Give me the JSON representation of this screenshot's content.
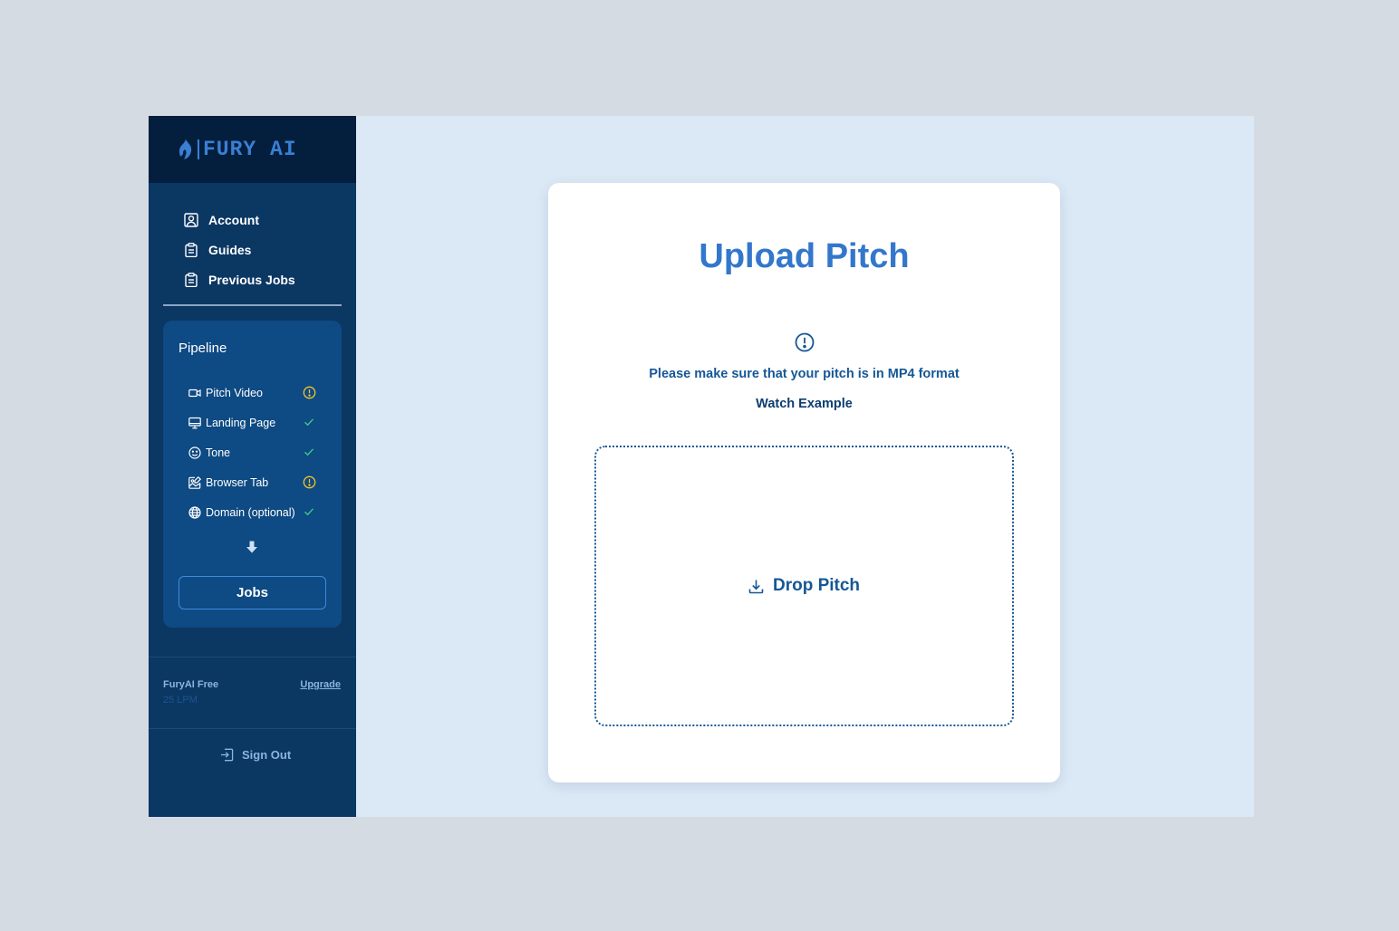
{
  "brand": {
    "name": "FURY AI",
    "logo_icon": "flame-logo",
    "color": "#3b7fd4"
  },
  "nav": {
    "items": [
      {
        "label": "Account",
        "icon": "user-square-icon"
      },
      {
        "label": "Guides",
        "icon": "clipboard-icon"
      },
      {
        "label": "Previous Jobs",
        "icon": "clipboard-icon"
      }
    ]
  },
  "pipeline": {
    "title": "Pipeline",
    "items": [
      {
        "label": "Pitch Video",
        "icon": "video-icon",
        "status": "warning"
      },
      {
        "label": "Landing Page",
        "icon": "monitor-icon",
        "status": "done"
      },
      {
        "label": "Tone",
        "icon": "smile-icon",
        "status": "done"
      },
      {
        "label": "Browser Tab",
        "icon": "image-edit-icon",
        "status": "warning"
      },
      {
        "label": "Domain (optional)",
        "icon": "globe-icon",
        "status": "done"
      }
    ],
    "jobs_button": "Jobs"
  },
  "account": {
    "plan": "FuryAI Free",
    "limit": "25 LPM",
    "upgrade_label": "Upgrade",
    "sign_out_label": "Sign Out"
  },
  "main": {
    "title": "Upload Pitch",
    "notice": "Please make sure that your pitch is in MP4 format",
    "watch_example": "Watch Example",
    "drop_label": "Drop Pitch"
  },
  "colors": {
    "sidebar_bg": "#0b3763",
    "brand_bg": "#041f3d",
    "pipeline_bg": "#0e4a83",
    "main_bg": "#dbe9f6",
    "accent": "#3377cc",
    "warning": "#f2c230",
    "success": "#3ec98a"
  }
}
